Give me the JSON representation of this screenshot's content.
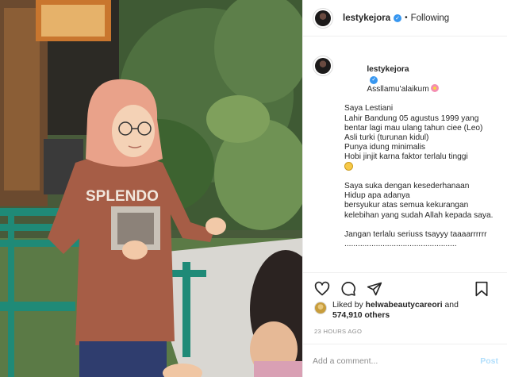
{
  "post": {
    "username": "lestykejora",
    "verified": true,
    "separator": "•",
    "follow_status": "Following"
  },
  "caption": {
    "username": "lestykejora",
    "first_line": "Assllamu'alaikum",
    "lines": [
      "Saya Lestiani",
      "Lahir Bandung 05 agustus 1999 yang bentar lagi mau ulang tahun ciee (Leo)",
      "Asli turki (turunan kidul)",
      "Punya idung minimalis",
      "Hobi jinjit karna faktor terlalu tinggi",
      "",
      "Saya suka dengan kesederhanaan",
      "Hidup apa adanya",
      "bersyukur atas semua kekurangan kelebihan yang sudah Allah kepada saya.",
      "",
      "Jangan terlalu seriuss tsayyy taaaarrrrrr",
      ".................................................."
    ]
  },
  "likes": {
    "prefix": "Liked by",
    "liker": "helwabeautycareori",
    "connector": "and",
    "count": "574,910 others"
  },
  "timestamp": "23 HOURS AGO",
  "comment": {
    "placeholder": "Add a comment...",
    "post_label": "Post"
  },
  "icons": {
    "like": "heart-icon",
    "comment": "comment-icon",
    "share": "share-icon",
    "save": "bookmark-icon"
  },
  "colors": {
    "verified": "#3897f0",
    "post_button_disabled": "#b2dffc",
    "muted_text": "#8e8e8e"
  }
}
